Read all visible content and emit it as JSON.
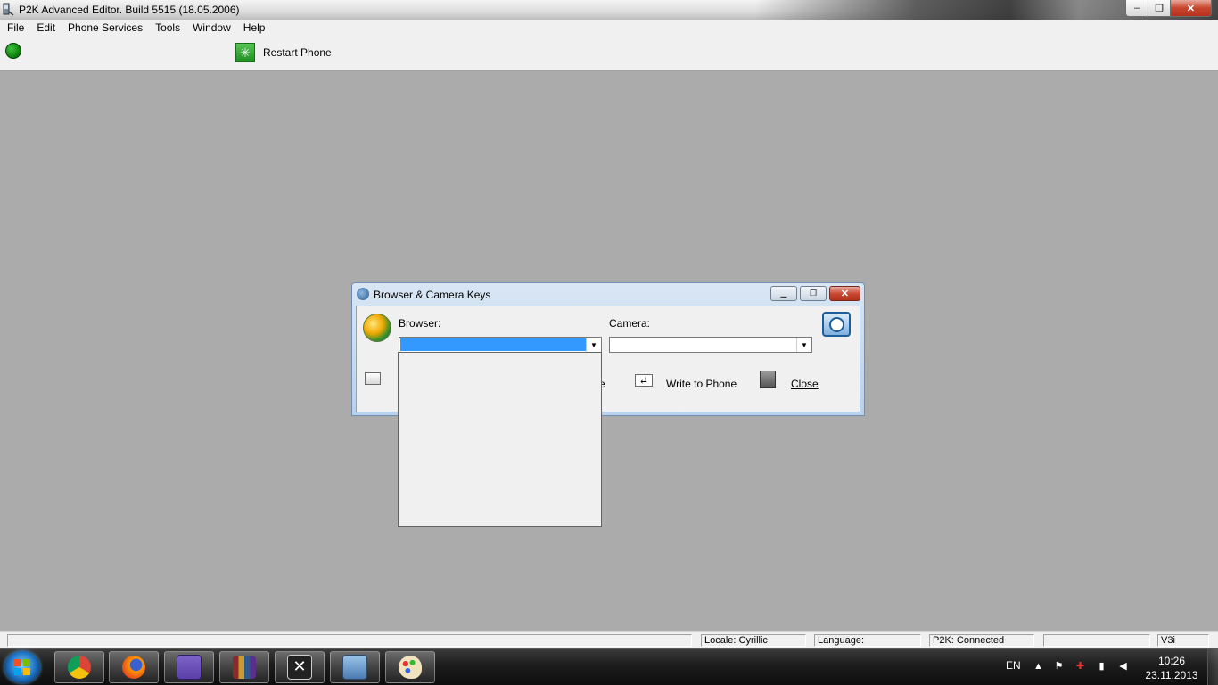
{
  "window": {
    "title": "P2K Advanced Editor. Build 5515 (18.05.2006)",
    "controls": {
      "minimize": "–",
      "maximize": "❐",
      "close": "✕"
    }
  },
  "menu": {
    "items": [
      "File",
      "Edit",
      "Phone Services",
      "Tools",
      "Window",
      "Help"
    ]
  },
  "toolbar": {
    "restart_label": "Restart Phone",
    "connection_color": "#1a9a1a"
  },
  "dialog": {
    "title": "Browser & Camera Keys",
    "browser_label": "Browser:",
    "camera_label": "Camera:",
    "browser_value": "",
    "camera_value": "",
    "save_partial": "e",
    "write_label": "Write to Phone",
    "close_label": "Close",
    "icons": {
      "title": "phone-icon",
      "browser": "globe-icon",
      "camera": "camera-icon",
      "read": "read-icon",
      "write": "write-icon",
      "close": "door-icon"
    }
  },
  "dropdown": {
    "options": []
  },
  "statusbar": {
    "locale": "Locale: Cyrillic",
    "language": "Language:",
    "connection": "P2K: Connected",
    "model": "V3i"
  },
  "taskbar": {
    "apps": [
      "chrome-icon",
      "firefox-icon",
      "save-disk-icon",
      "books-icon",
      "crossed-icon",
      "phone-app-icon",
      "paint-icon"
    ],
    "lang": "EN",
    "time": "10:26",
    "date": "23.11.2013"
  },
  "colors": {
    "selection": "#3399ff",
    "mdi_background": "#ababab",
    "dialog_frame": "#b9d1ea"
  }
}
